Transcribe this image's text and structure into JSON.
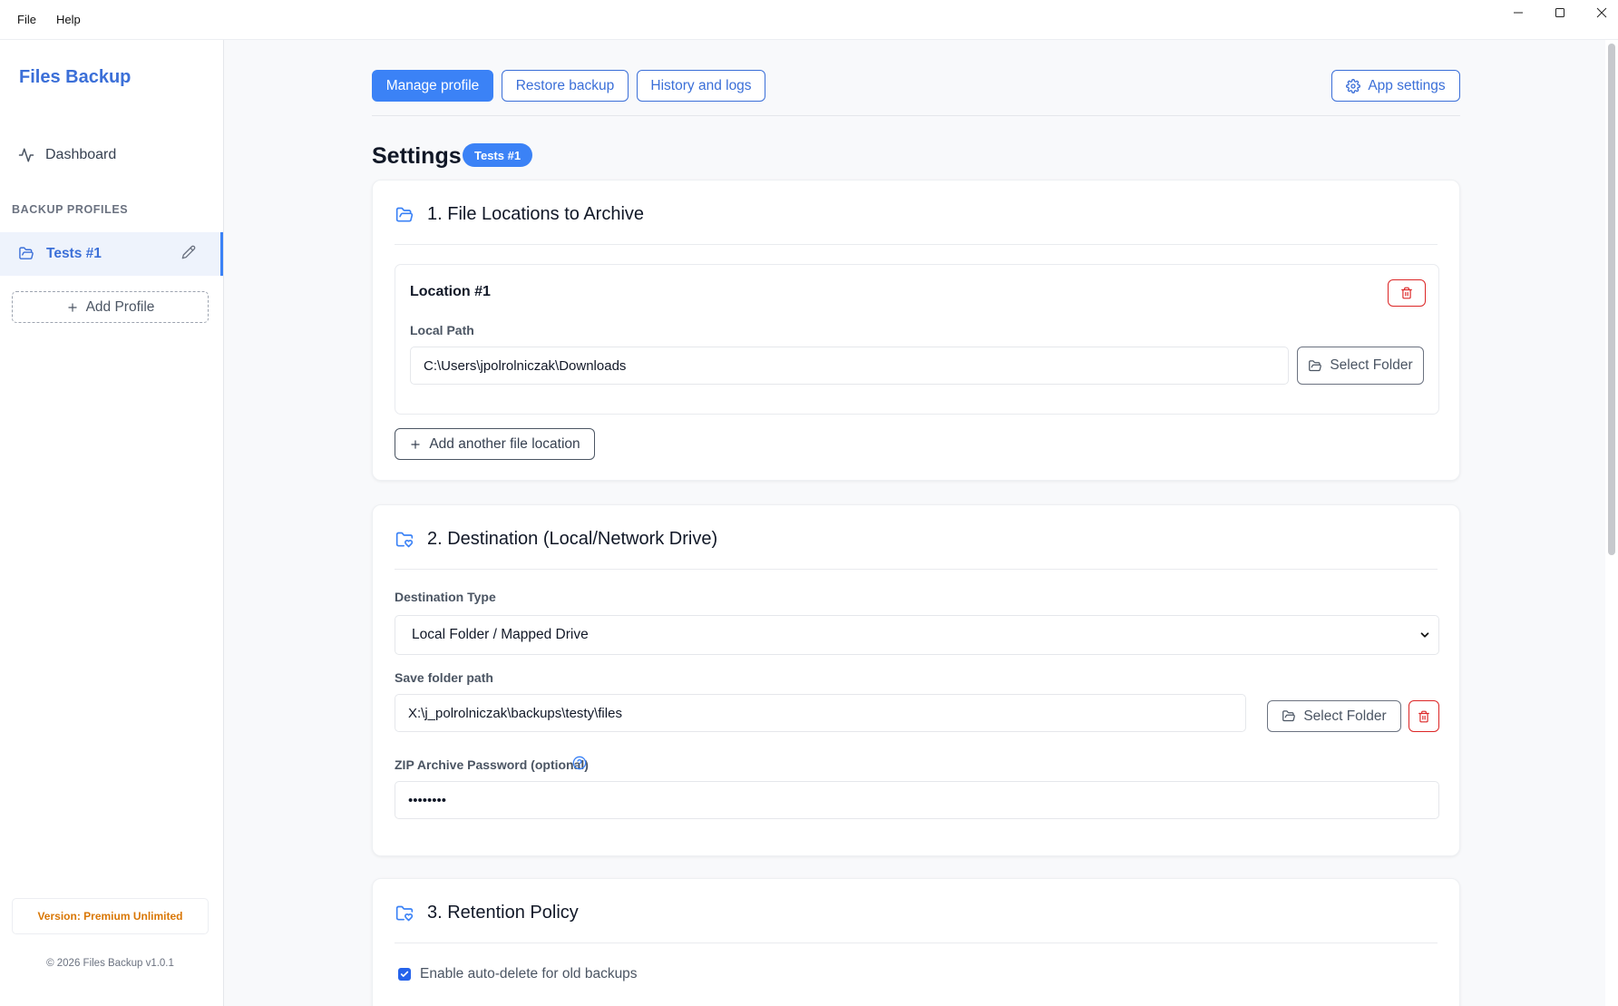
{
  "menubar": {
    "file": "File",
    "help": "Help"
  },
  "sidebar": {
    "brand": "Files Backup",
    "dashboard": "Dashboard",
    "section_label": "BACKUP PROFILES",
    "profiles": [
      {
        "name": "Tests #1"
      }
    ],
    "add_profile": "Add Profile",
    "version": "Version: Premium Unlimited",
    "copyright": "© 2026 Files Backup v1.0.1"
  },
  "toolbar": {
    "manage_profile": "Manage profile",
    "restore_backup": "Restore backup",
    "history_logs": "History and logs",
    "app_settings": "App settings"
  },
  "settings": {
    "title": "Settings",
    "badge": "Tests #1"
  },
  "section1": {
    "title": "1. File Locations to Archive",
    "location_title": "Location #1",
    "local_path_label": "Local Path",
    "local_path_value": "C:\\Users\\jpolrolniczak\\Downloads",
    "select_folder": "Select Folder",
    "add_location": "Add another file location"
  },
  "section2": {
    "title": "2. Destination (Local/Network Drive)",
    "destination_type_label": "Destination Type",
    "destination_type_value": "Local Folder / Mapped Drive",
    "save_path_label": "Save folder path",
    "save_path_value": "X:\\j_polrolniczak\\backups\\testy\\files",
    "select_folder": "Select Folder",
    "zip_password_label": "ZIP Archive Password (optional)",
    "zip_password_value": "••••••••"
  },
  "section3": {
    "title": "3. Retention Policy",
    "auto_delete_label": "Enable auto-delete for old backups",
    "auto_delete_checked": true
  },
  "colors": {
    "accent": "#3b82f6",
    "danger": "#dc2626",
    "warning": "#d97706"
  }
}
